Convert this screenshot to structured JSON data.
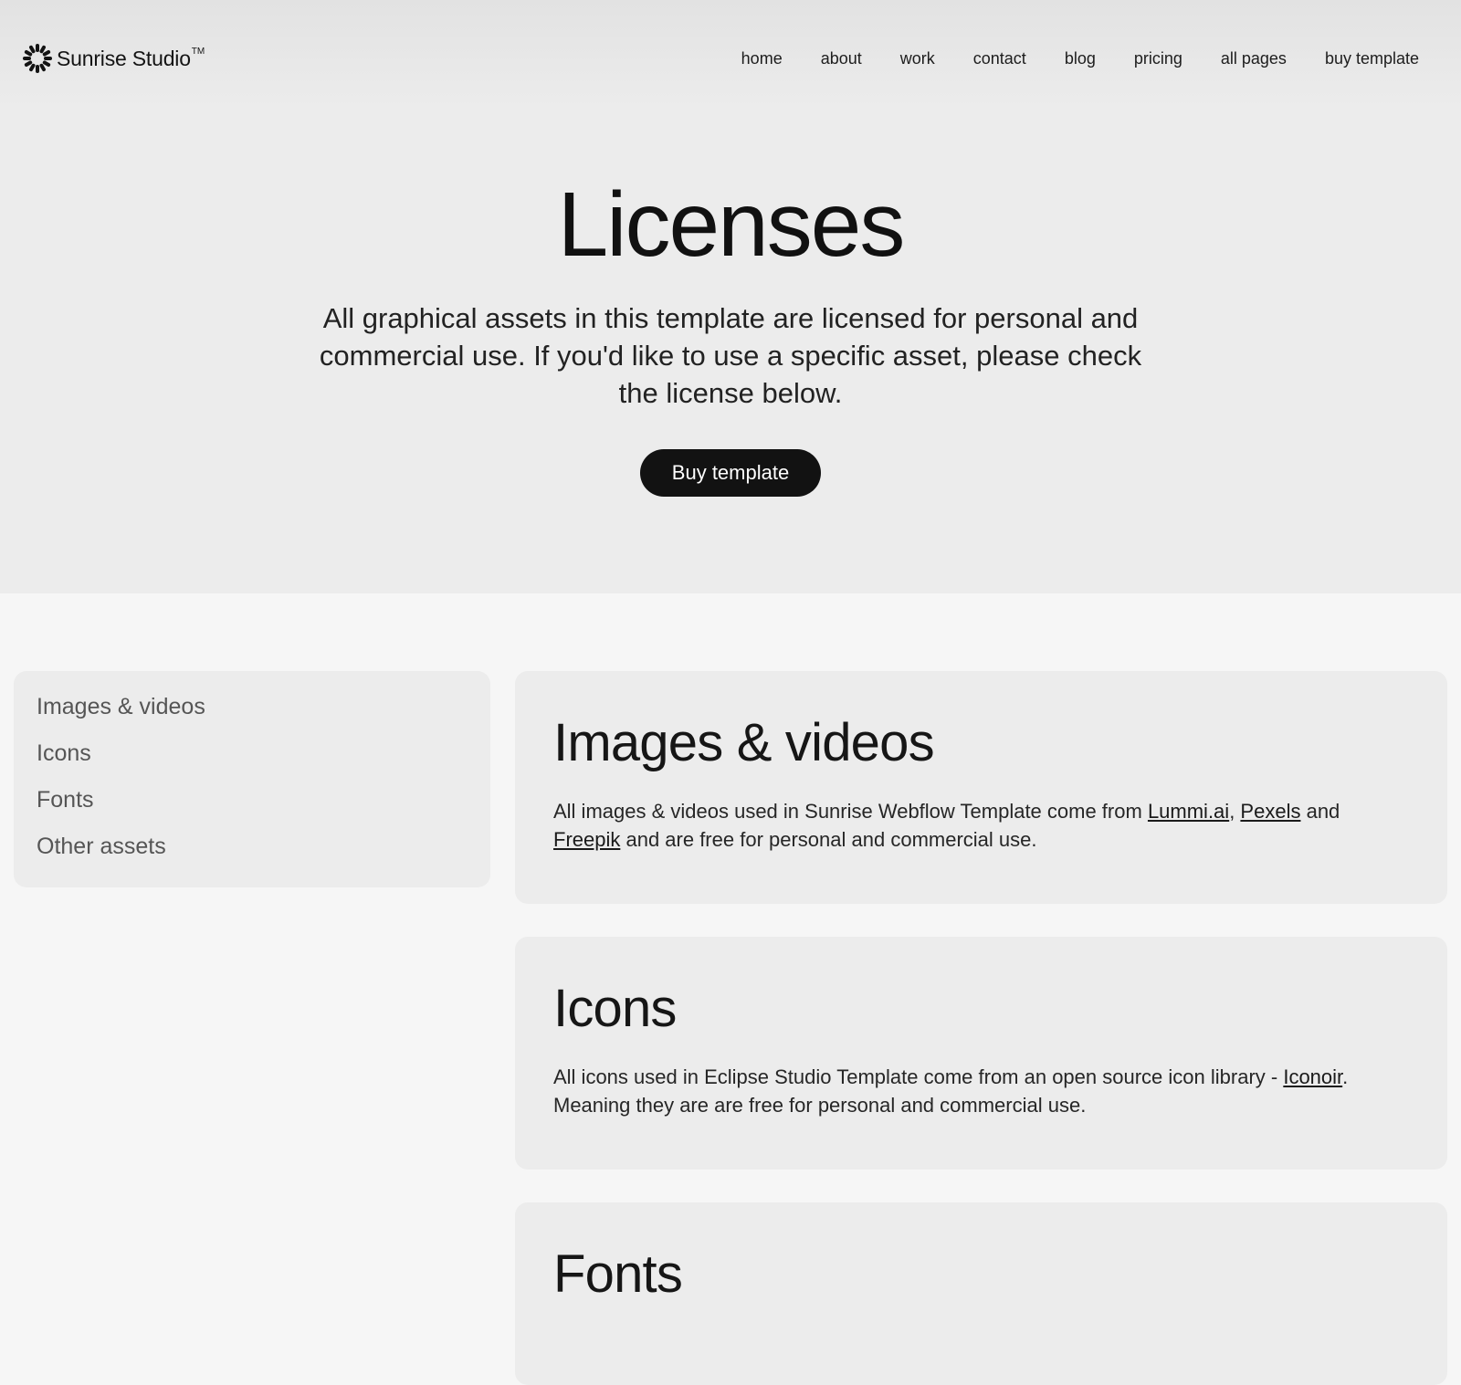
{
  "brand": {
    "name": "Sunrise Studio",
    "trademark": "TM",
    "icon": "sunburst-logo-icon"
  },
  "nav": {
    "items": [
      {
        "label": "home"
      },
      {
        "label": "about"
      },
      {
        "label": "work"
      },
      {
        "label": "contact"
      },
      {
        "label": "blog"
      },
      {
        "label": "pricing"
      },
      {
        "label": "all pages"
      },
      {
        "label": "buy template"
      }
    ]
  },
  "hero": {
    "title": "Licenses",
    "subtitle": "All graphical assets in this template are licensed for personal and commercial use. If you'd like to use a specific asset, please check the license below.",
    "button_label": "Buy template"
  },
  "toc": {
    "items": [
      {
        "label": "Images & videos"
      },
      {
        "label": "Icons"
      },
      {
        "label": "Fonts"
      },
      {
        "label": "Other assets"
      }
    ]
  },
  "sections": {
    "images": {
      "title": "Images & videos",
      "text_1": "All images & videos used in Sunrise Webflow Template come from ",
      "link_1": "Lummi.ai",
      "text_2": ", ",
      "link_2": "Pexels",
      "text_3": " and ",
      "link_3": "Freepik",
      "text_4": " and are free for personal and commercial use."
    },
    "icons": {
      "title": "Icons",
      "text_1": "All icons used in Eclipse Studio Template come from an open source icon library - ",
      "link_1": "Iconoir",
      "text_2": ". Meaning they are are free for personal and commercial use."
    },
    "fonts": {
      "title": "Fonts"
    }
  },
  "colors": {
    "hero_bg": "#ececec",
    "page_bg": "#f6f6f6",
    "card_bg": "#ececec",
    "button_bg": "#121212",
    "button_text": "#ffffff",
    "text": "#1a1a1a"
  }
}
